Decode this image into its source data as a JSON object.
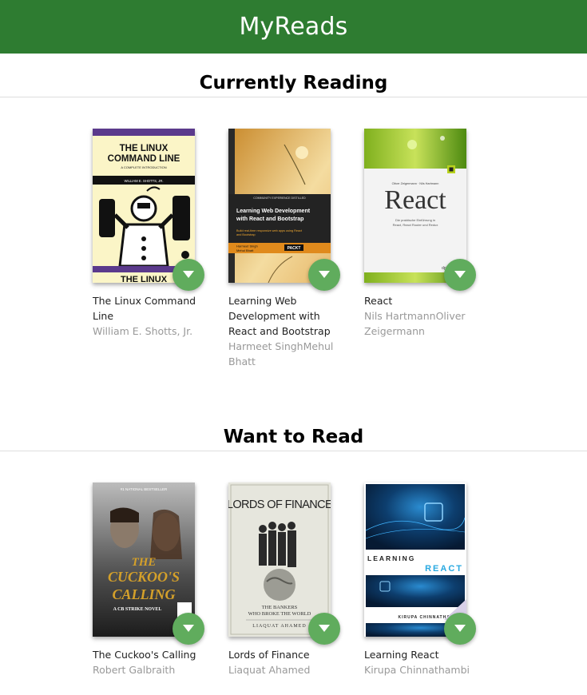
{
  "header": {
    "title": "MyReads"
  },
  "shelves": [
    {
      "title": "Currently Reading",
      "books": [
        {
          "title": "The Linux Command Line",
          "authors": "William E. Shotts, Jr.",
          "cover": {
            "top_text": "THE LINUX",
            "top_text2": "COMMAND LINE",
            "subtitle": "A COMPLETE INTRODUCTION",
            "author_band": "WILLIAM E. SHOTTS, JR.",
            "bottom_text": "THE LINUX"
          }
        },
        {
          "title": "Learning Web Development with React and Bootstrap",
          "authors": "Harmeet SinghMehul Bhatt",
          "cover": {
            "series": "COMMUNITY EXPERIENCE DISTILLED",
            "title1": "Learning Web Development",
            "title2": "with React and Bootstrap",
            "tagline1": "Build real-time responsive web apps using React",
            "tagline2": "and Bootstrap",
            "author1": "Harmeet Singh",
            "author2": "Mehul Bhatt",
            "publisher": "PACKT"
          }
        },
        {
          "title": "React",
          "authors": "Nils HartmannOliver Zeigermann",
          "cover": {
            "authors_line": "Oliver Zeigermann · Nils Hartmann",
            "big": "React",
            "sub1": "Die praktische Einführung in",
            "sub2": "React, React Router und Redux",
            "publisher": "dpunkt"
          }
        }
      ]
    },
    {
      "title": "Want to Read",
      "books": [
        {
          "title": "The Cuckoo's Calling",
          "authors": "Robert Galbraith",
          "cover": {
            "badge": "#1 NATIONAL BESTSELLER",
            "line1": "THE",
            "line2": "CUCKOO'S",
            "line3": "CALLING",
            "series": "A CB STRIKE NOVEL"
          }
        },
        {
          "title": "Lords of Finance",
          "authors": "Liaquat Ahamed",
          "cover": {
            "big": "LORDS OF FINANCE",
            "sub1": "THE BANKERS",
            "sub2": "WHO BROKE THE WORLD",
            "author": "LIAQUAT AHAMED"
          }
        },
        {
          "title": "Learning React",
          "authors": "Kirupa Chinnathambi",
          "cover": {
            "word1": "LEARNING",
            "word2": "REACT",
            "author": "KIRUPA CHINNATHAMBI"
          }
        }
      ]
    }
  ],
  "colors": {
    "header": "#2e7c31",
    "changer": "#60ac5d"
  },
  "icons": {
    "changer": "triangle-down-icon"
  }
}
